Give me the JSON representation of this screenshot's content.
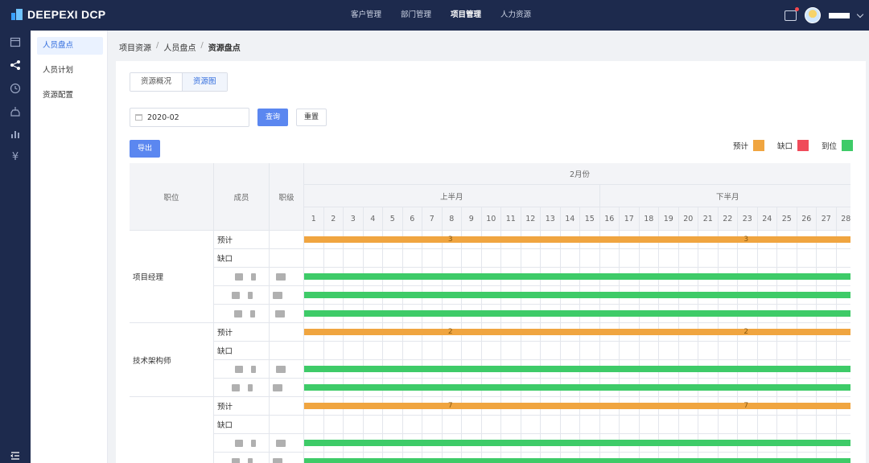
{
  "app": {
    "logo_text": "DEEPEXI DCP"
  },
  "topnav": [
    {
      "label": "客户管理"
    },
    {
      "label": "部门管理"
    },
    {
      "label": "项目管理",
      "active": true
    },
    {
      "label": "人力资源"
    }
  ],
  "rail_icons": [
    "calendar-icon",
    "share-icon",
    "clock-icon",
    "inbox-icon",
    "bar-chart-icon",
    "yen-icon"
  ],
  "sidebar": {
    "items": [
      {
        "label": "人员盘点",
        "active": true
      },
      {
        "label": "人员计划"
      },
      {
        "label": "资源配置"
      }
    ]
  },
  "breadcrumb": {
    "items": [
      "项目资源",
      "人员盘点",
      "资源盘点"
    ],
    "separator": "/"
  },
  "tabs": [
    {
      "label": "资源概况"
    },
    {
      "label": "资源图",
      "active": true
    }
  ],
  "filter": {
    "month_value": "2020-02",
    "query_label": "查询",
    "reset_label": "重置"
  },
  "export_label": "导出",
  "legend": [
    {
      "label": "预计",
      "color": "#f0a540"
    },
    {
      "label": "缺口",
      "color": "#f04b5a"
    },
    {
      "label": "到位",
      "color": "#3ecb68"
    }
  ],
  "table": {
    "headers": {
      "position": "职位",
      "member": "成员",
      "level": "职级",
      "month": "2月份",
      "first_half": "上半月",
      "second_half": "下半月"
    },
    "days": [
      "1",
      "2",
      "3",
      "4",
      "5",
      "6",
      "7",
      "8",
      "9",
      "10",
      "11",
      "12",
      "13",
      "14",
      "15",
      "16",
      "17",
      "18",
      "19",
      "20",
      "21",
      "22",
      "23",
      "24",
      "25",
      "26",
      "27",
      "28"
    ],
    "groups": [
      {
        "position": "项目经理",
        "rows": [
          {
            "label": "预计",
            "type": "forecast",
            "first_value": "3",
            "second_value": "3"
          },
          {
            "label": "缺口",
            "type": "gap"
          },
          {
            "label": "",
            "type": "in-place"
          },
          {
            "label": "",
            "type": "in-place"
          },
          {
            "label": "",
            "type": "in-place"
          }
        ]
      },
      {
        "position": "技术架构师",
        "rows": [
          {
            "label": "预计",
            "type": "forecast",
            "first_value": "2",
            "second_value": "2"
          },
          {
            "label": "缺口",
            "type": "gap"
          },
          {
            "label": "",
            "type": "in-place"
          },
          {
            "label": "",
            "type": "in-place"
          }
        ]
      },
      {
        "position": "",
        "rows": [
          {
            "label": "预计",
            "type": "forecast",
            "first_value": "7",
            "second_value": "7"
          },
          {
            "label": "缺口",
            "type": "gap"
          },
          {
            "label": "",
            "type": "in-place"
          },
          {
            "label": "",
            "type": "in-place"
          }
        ]
      }
    ]
  }
}
